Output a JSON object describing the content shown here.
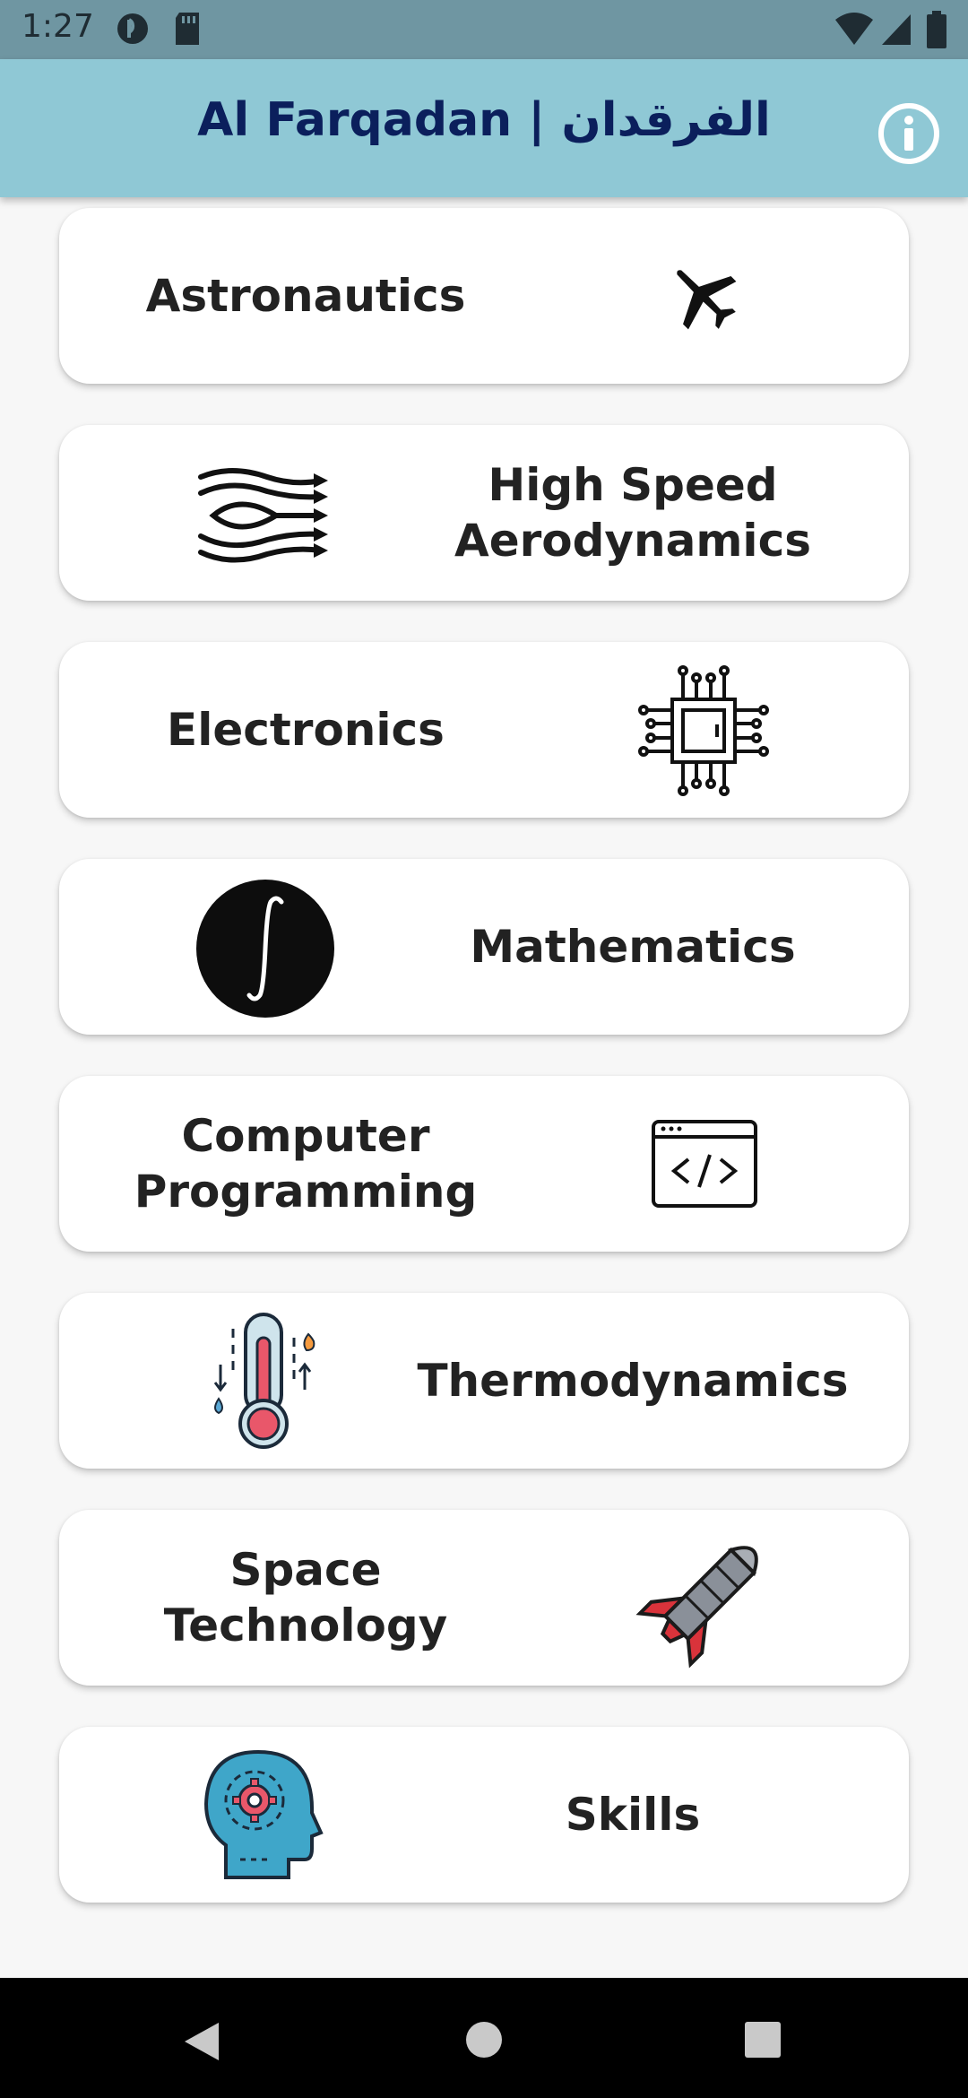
{
  "status_bar": {
    "time": "1:27",
    "icons": [
      "app-badge-icon",
      "sd-card-icon",
      "wifi-icon",
      "signal-icon",
      "battery-icon"
    ]
  },
  "app_bar": {
    "title": "Al Farqadan | الفرقدان",
    "info_icon": "info-icon",
    "background_color": "#8fc8d5",
    "title_color": "#0b1f5c"
  },
  "topics": [
    {
      "label": "Astronautics",
      "icon": "airplane-icon"
    },
    {
      "label": "High Speed\nAerodynamics",
      "icon": "airflow-icon"
    },
    {
      "label": "Electronics",
      "icon": "microchip-icon"
    },
    {
      "label": "Mathematics",
      "icon": "integral-icon"
    },
    {
      "label": "Computer\nProgramming",
      "icon": "code-window-icon"
    },
    {
      "label": "Thermodynamics",
      "icon": "thermometer-icon"
    },
    {
      "label": "Space\nTechnology",
      "icon": "rocket-icon"
    },
    {
      "label": "Skills",
      "icon": "head-gear-icon"
    }
  ],
  "nav_bar": {
    "icons": [
      "back-icon",
      "home-icon",
      "recents-icon"
    ]
  }
}
